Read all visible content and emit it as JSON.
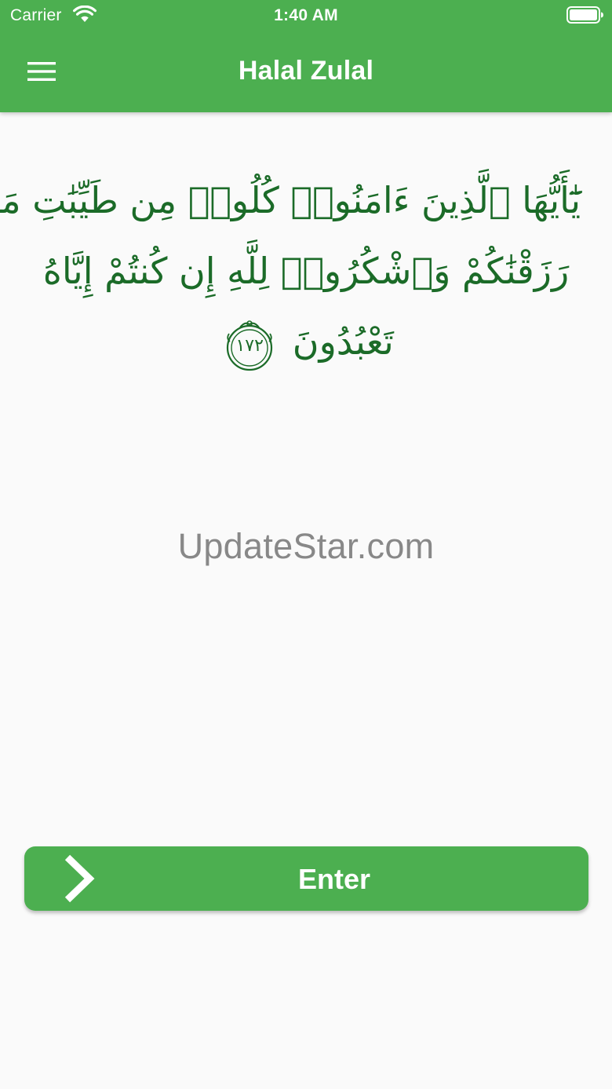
{
  "status_bar": {
    "carrier": "Carrier",
    "time": "1:40 AM",
    "wifi_icon": "wifi-icon",
    "battery_icon": "battery-full-icon"
  },
  "app_bar": {
    "title": "Halal Zulal",
    "menu_icon": "hamburger-menu-icon",
    "background_color": "#4caf50"
  },
  "verse": {
    "lines": [
      "يَٰٓأَيُّهَا ٱلَّذِينَ ءَامَنُوا۟ كُلُوا۟ مِن طَيِّبَٰتِ مَا",
      "رَزَقْنَٰكُمْ وَٱشْكُرُوا۟ لِلَّهِ إِن كُنتُمْ إِيَّاهُ",
      "تَعْبُدُونَ"
    ],
    "number": "١٧٢",
    "color": "#1b6b28"
  },
  "watermark": "UpdateStar.com",
  "enter_button": {
    "label": "Enter",
    "icon": "chevron-right-icon"
  }
}
